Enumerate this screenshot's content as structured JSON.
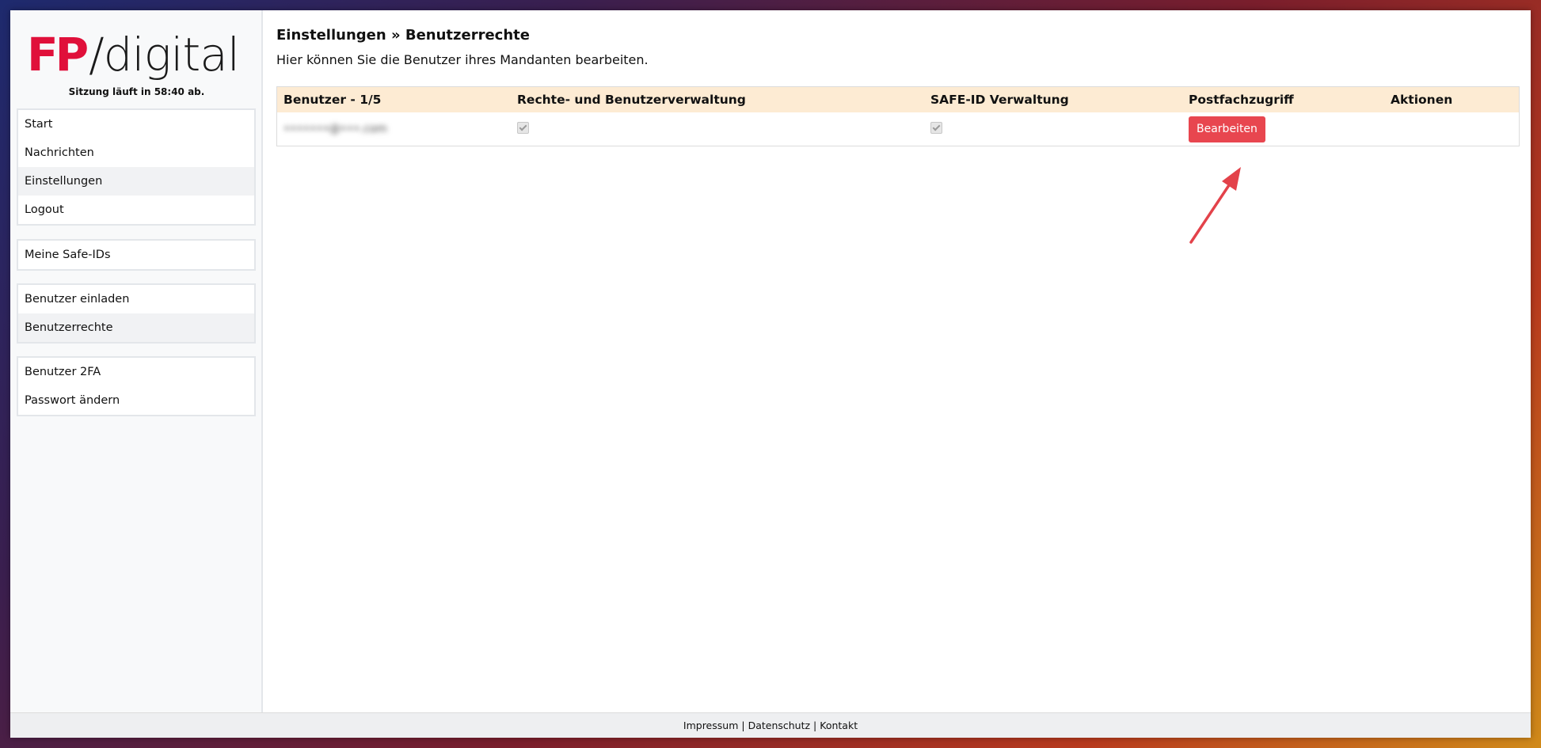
{
  "brand": {
    "logo_mark": "FP",
    "logo_text": "/digital",
    "accent_color": "#e0103a"
  },
  "session": {
    "text": "Sitzung läuft in 58:40 ab."
  },
  "sidebar": {
    "group1": [
      {
        "label": "Start"
      },
      {
        "label": "Nachrichten"
      },
      {
        "label": "Einstellungen"
      },
      {
        "label": "Logout"
      }
    ],
    "group2": [
      {
        "label": "Meine Safe-IDs"
      }
    ],
    "group3": [
      {
        "label": "Benutzer einladen"
      },
      {
        "label": "Benutzerrechte"
      }
    ],
    "group4": [
      {
        "label": "Benutzer 2FA"
      },
      {
        "label": "Passwort ändern"
      }
    ]
  },
  "main": {
    "title": "Einstellungen » Benutzerrechte",
    "description": "Hier können Sie die Benutzer ihres Mandanten bearbeiten.",
    "table": {
      "headers": [
        "Benutzer - 1/5",
        "Rechte- und Benutzerverwaltung",
        "SAFE-ID Verwaltung",
        "Postfachzugriff",
        "Aktionen"
      ],
      "rows": [
        {
          "user": "•••••••@•••.com",
          "rights_checked": true,
          "safeid_checked": true,
          "action_label": "Bearbeiten"
        }
      ]
    }
  },
  "footer": {
    "impressum": "Impressum",
    "datenschutz": "Datenschutz",
    "kontakt": "Kontakt",
    "separator": "|"
  },
  "annotation": {
    "arrow_color": "#e3424a",
    "arrow_icon": "annotation-arrow-icon"
  }
}
